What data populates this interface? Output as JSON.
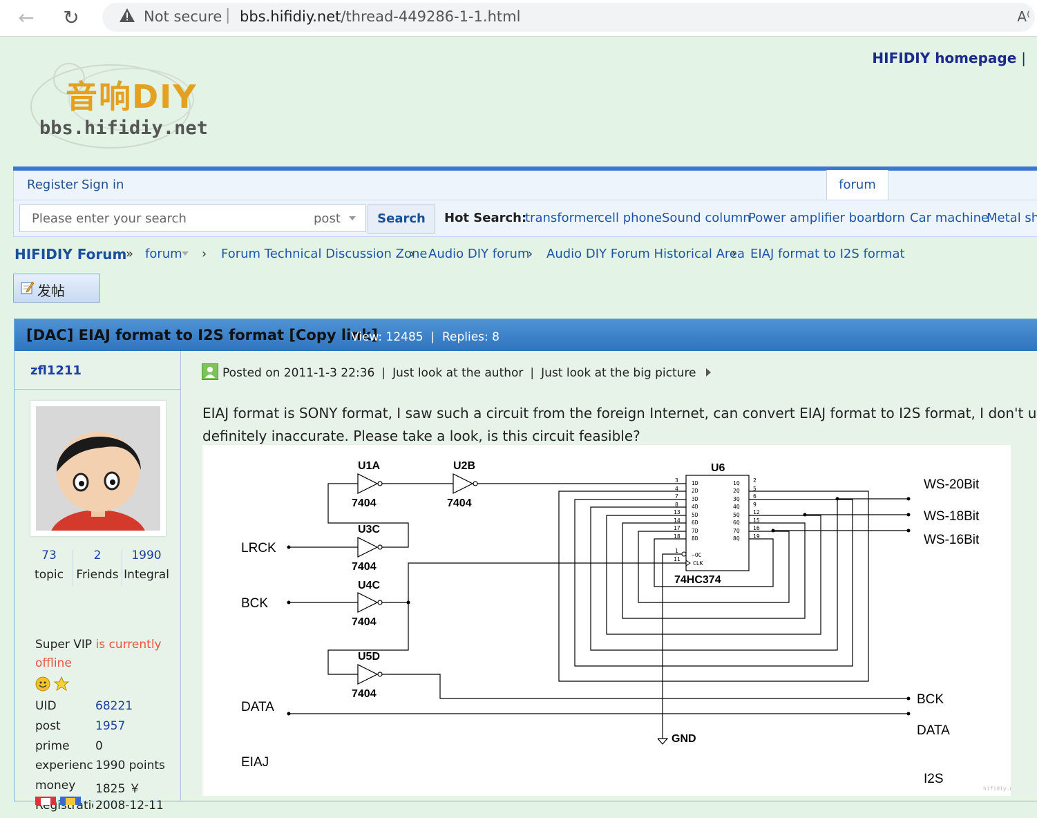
{
  "browser": {
    "not_secure": "Not secure",
    "url_host": "bbs.hifidiy.net",
    "url_path": "/thread-449286-1-1.html"
  },
  "header": {
    "logo_cn": "音响DIY",
    "logo_domain": "bbs.hifidiy.net",
    "homepage": "HIFIDIY homepage"
  },
  "userbar": {
    "register": "Register",
    "signin": "Sign in",
    "forum_tab": "forum"
  },
  "search": {
    "placeholder": "Please enter your search",
    "type": "post",
    "button": "Search",
    "hot_label": "Hot Search:",
    "hot": [
      "transformer",
      "cell phone",
      "Sound column",
      "Power amplifier board",
      "horn",
      "Car machine",
      "Metal she"
    ]
  },
  "breadcrumb": {
    "home": "HIFIDIY Forum",
    "items": [
      "forum",
      "Forum Technical Discussion Zone",
      "Audio DIY forum",
      "Audio DIY Forum Historical Area",
      "EIAJ format to I2S format"
    ]
  },
  "post_button": "发帖",
  "thread": {
    "title": "[DAC] EIAJ format to I2S format [Copy link]",
    "views": "View: 12485",
    "replies": "Replies: 8"
  },
  "author": {
    "name": "zfl1211",
    "topic": "73",
    "topic_label": "topic",
    "friends": "2",
    "friends_label": "Friends",
    "integral": "1990",
    "integral_label": "Integral",
    "group": "Super VIP",
    "status": "is currently offline",
    "uid_label": "UID",
    "uid": "68221",
    "post_label": "post",
    "post": "1957",
    "prime_label": "prime",
    "prime": "0",
    "experience_label": "experience",
    "experience": "1990 points",
    "money_label": "money",
    "money": "1825 ￥",
    "registration_label": "Registration",
    "registration": "2008-12-11"
  },
  "post": {
    "posted": "Posted on 2011-1-3 22:36",
    "just_author": "Just look at the author",
    "big_picture": "Just look at the big picture",
    "line1": "EIAJ format is SONY format, I saw such a circuit from the foreign Internet, can convert EIAJ format to I2S format, I don't understa",
    "line2": "definitely inaccurate. Please take a look, is this circuit feasible?"
  },
  "diagram": {
    "u1a": "U1A",
    "u2b": "U2B",
    "u3c": "U3C",
    "u4c": "U4C",
    "u5d": "U5D",
    "u6": "U6",
    "part": "7404",
    "chip": "74HC374",
    "lrck": "LRCK",
    "bck_in": "BCK",
    "data_in": "DATA",
    "eiaj": "EIAJ",
    "ws20": "WS-20Bit",
    "ws18": "WS-18Bit",
    "ws16": "WS-16Bit",
    "bck_out": "BCK",
    "data_out": "DATA",
    "i2s": "I2S",
    "gnd": "GND",
    "watermark": "hifidiy.net"
  }
}
